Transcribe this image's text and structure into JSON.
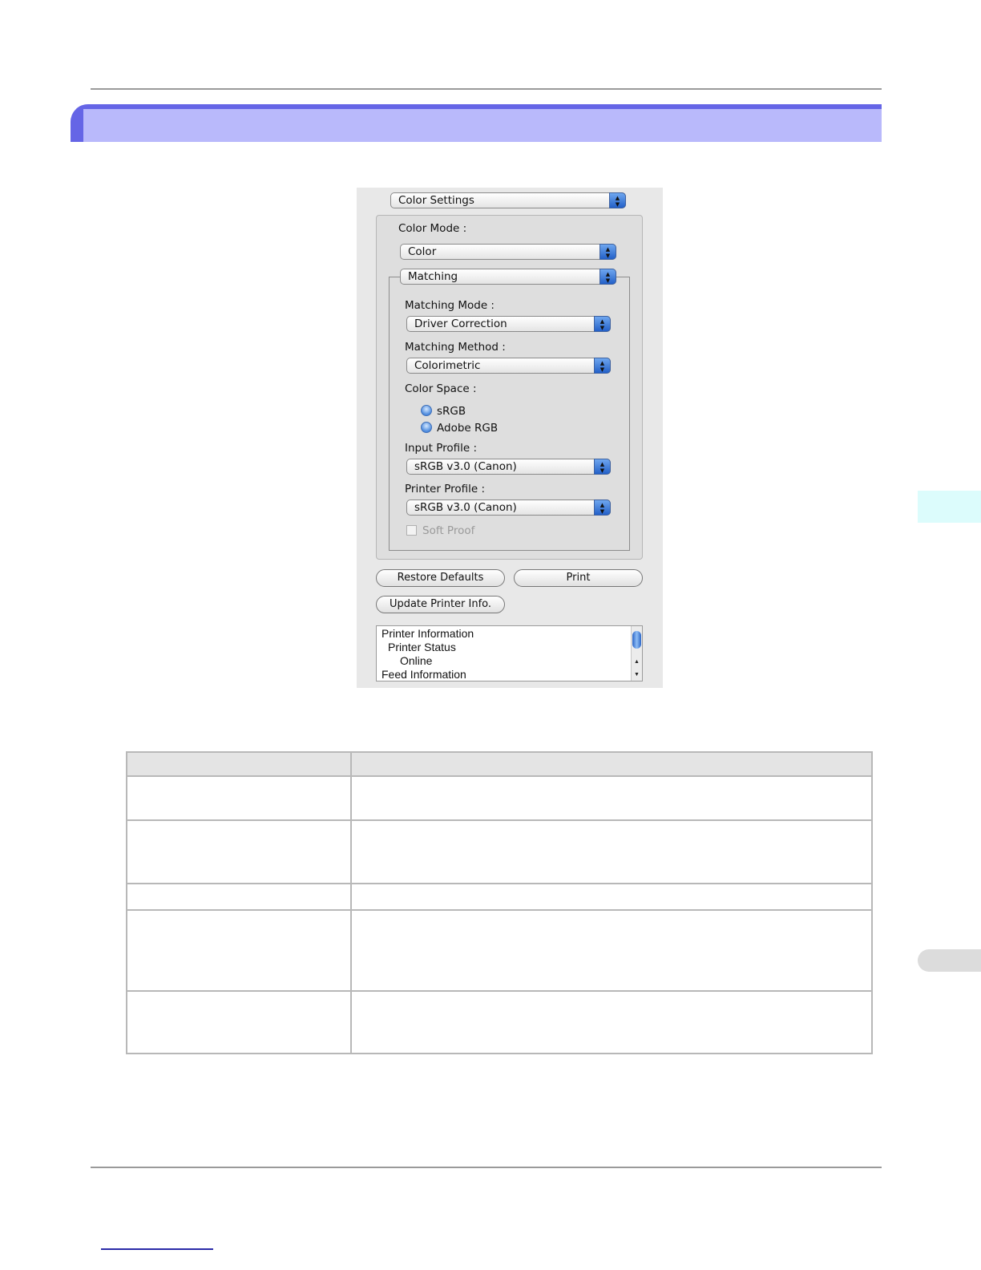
{
  "dialog": {
    "panel_select": "Color Settings",
    "color_mode_label": "Color Mode :",
    "color_mode_value": "Color",
    "section_select": "Matching",
    "matching_mode_label": "Matching Mode :",
    "matching_mode_value": "Driver Correction",
    "matching_method_label": "Matching Method :",
    "matching_method_value": "Colorimetric",
    "color_space_label": "Color Space :",
    "color_space_options": [
      "sRGB",
      "Adobe RGB"
    ],
    "input_profile_label": "Input Profile :",
    "input_profile_value": "sRGB v3.0 (Canon)",
    "printer_profile_label": "Printer Profile :",
    "printer_profile_value": "sRGB v3.0 (Canon)",
    "soft_proof_label": "Soft Proof",
    "restore_defaults_label": "Restore Defaults",
    "print_label": "Print",
    "update_info_label": "Update Printer Info.",
    "info_lines": [
      "Printer Information",
      "Printer Status",
      "Online",
      "Feed Information"
    ]
  },
  "table": {
    "rows": 5
  }
}
